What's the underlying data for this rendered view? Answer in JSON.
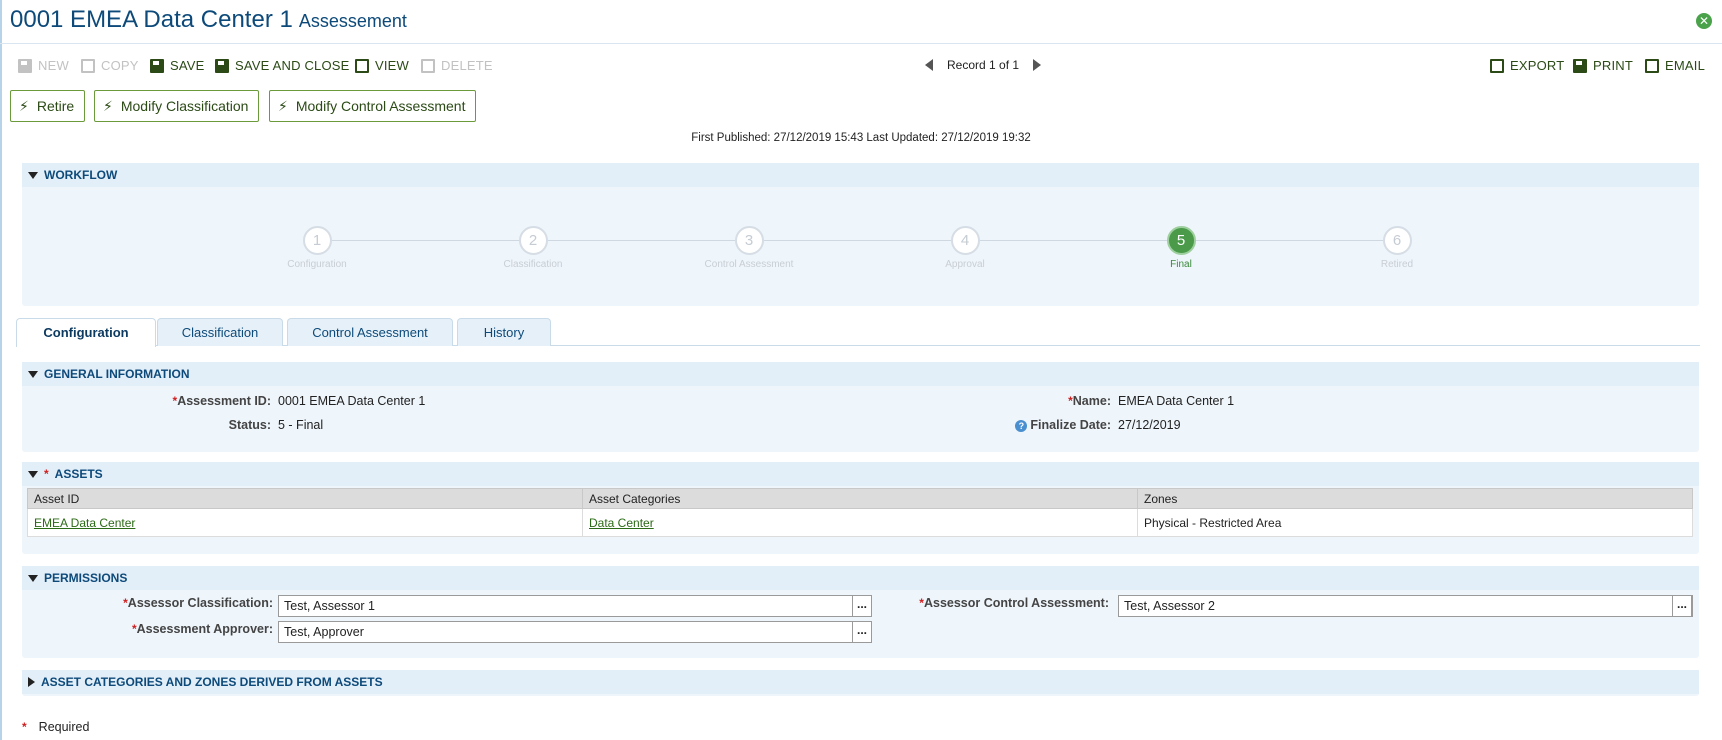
{
  "title": {
    "main": "0001 EMEA Data Center 1",
    "sub": "Assessement"
  },
  "toolbar": {
    "new": "NEW",
    "copy": "COPY",
    "save": "SAVE",
    "save_close": "SAVE AND CLOSE",
    "view": "VIEW",
    "delete": "DELETE",
    "record": "Record 1 of 1",
    "export": "EXPORT",
    "print": "PRINT",
    "email": "EMAIL"
  },
  "actions": {
    "retire": "Retire",
    "modify_classification": "Modify Classification",
    "modify_control": "Modify Control Assessment"
  },
  "published": "First Published: 27/12/2019 15:43 Last Updated: 27/12/2019 19:32",
  "workflow": {
    "heading": "WORKFLOW",
    "current_step": 5,
    "steps": [
      {
        "num": "1",
        "label": "Configuration"
      },
      {
        "num": "2",
        "label": "Classification"
      },
      {
        "num": "3",
        "label": "Control Assessment"
      },
      {
        "num": "4",
        "label": "Approval"
      },
      {
        "num": "5",
        "label": "Final"
      },
      {
        "num": "6",
        "label": "Retired"
      }
    ]
  },
  "tabs": [
    {
      "label": "Configuration",
      "active": true
    },
    {
      "label": "Classification",
      "active": false
    },
    {
      "label": "Control Assessment",
      "active": false
    },
    {
      "label": "History",
      "active": false
    }
  ],
  "general": {
    "heading": "GENERAL INFORMATION",
    "assessment_id_label": "Assessment ID:",
    "assessment_id": "0001 EMEA Data Center 1",
    "status_label": "Status:",
    "status": "5 - Final",
    "name_label": "Name:",
    "name": "EMEA Data Center 1",
    "finalize_label": "Finalize Date:",
    "finalize_date": "27/12/2019"
  },
  "assets": {
    "heading": "ASSETS",
    "columns": [
      "Asset ID",
      "Asset Categories",
      "Zones"
    ],
    "rows": [
      {
        "asset_id": "EMEA Data Center",
        "category": "Data Center",
        "zone": "Physical - Restricted Area"
      }
    ]
  },
  "permissions": {
    "heading": "PERMISSIONS",
    "assessor_classification_label": "Assessor Classification:",
    "assessor_classification": "Test, Assessor 1",
    "assessment_approver_label": "Assessment Approver:",
    "assessment_approver": "Test, Approver",
    "assessor_control_label": "Assessor Control Assessment:",
    "assessor_control": "Test, Assessor 2",
    "more": "..."
  },
  "derived": {
    "heading": "ASSET CATEGORIES AND ZONES DERIVED FROM ASSETS"
  },
  "legend": {
    "required_mark": "*",
    "required": "Required"
  },
  "colors": {
    "title": "#0d4a7a",
    "accent_green": "#4a9a4a",
    "panel_bg": "#eef5fb",
    "required": "#d02020"
  }
}
